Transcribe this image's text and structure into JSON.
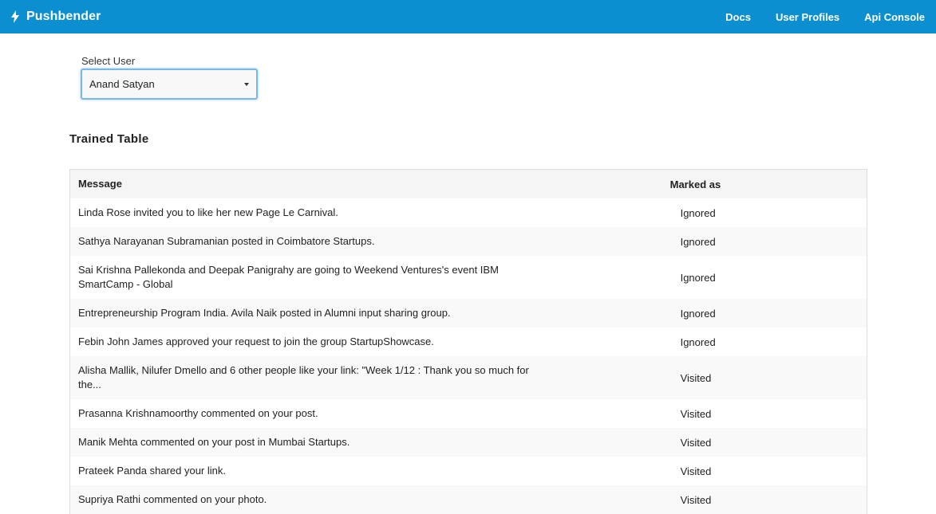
{
  "navbar": {
    "brand": "Pushbender",
    "links": [
      "Docs",
      "User Profiles",
      "Api Console"
    ],
    "background": "#0b8fd0"
  },
  "user_select": {
    "label": "Select User",
    "selected": "Anand Satyan"
  },
  "section_title": "Trained Table",
  "table": {
    "headers": [
      "Message",
      "Marked as"
    ],
    "rows": [
      {
        "message": "Linda Rose invited you to like her new Page Le Carnival.",
        "marked": "Ignored"
      },
      {
        "message": "Sathya Narayanan Subramanian posted in Coimbatore Startups.",
        "marked": "Ignored"
      },
      {
        "message": "Sai Krishna Pallekonda and Deepak Panigrahy are going to Weekend Ventures's event IBM SmartCamp - Global",
        "marked": "Ignored"
      },
      {
        "message": "Entrepreneurship Program India. Avila Naik posted in Alumni input sharing group.",
        "marked": "Ignored"
      },
      {
        "message": "Febin John James approved your request to join the group StartupShowcase.",
        "marked": "Ignored"
      },
      {
        "message": "Alisha Mallik, Nilufer Dmello and 6 other people like your link: \"Week 1/12 : Thank you so much for the...",
        "marked": "Visited"
      },
      {
        "message": "Prasanna Krishnamoorthy commented on your post.",
        "marked": "Visited"
      },
      {
        "message": "Manik Mehta commented on your post in Mumbai Startups.",
        "marked": "Visited"
      },
      {
        "message": "Prateek Panda shared your link.",
        "marked": "Visited"
      },
      {
        "message": "Supriya Rathi commented on your photo.",
        "marked": "Visited"
      }
    ]
  }
}
